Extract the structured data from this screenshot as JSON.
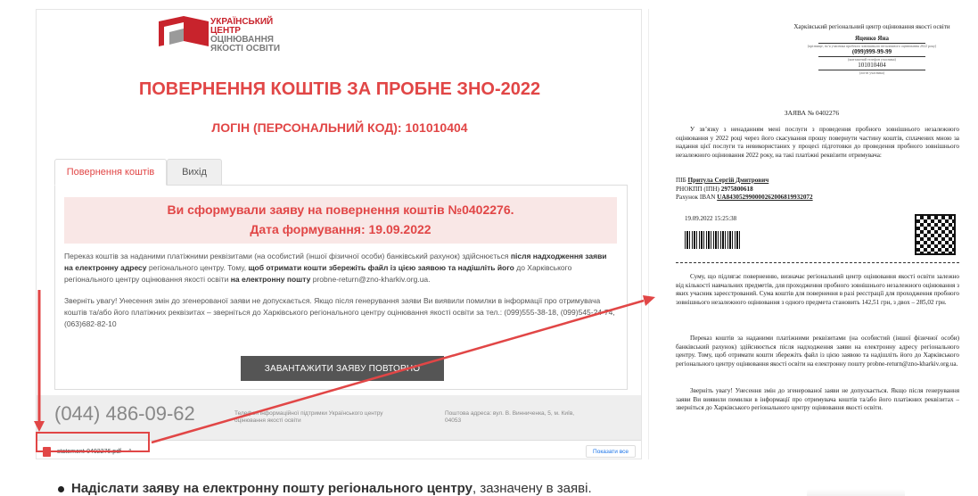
{
  "site": {
    "logo_lines": [
      "УКРАЇНСЬКИЙ",
      "ЦЕНТР",
      "ОЦІНЮВАННЯ",
      "ЯКОСТІ ОСВІТИ"
    ],
    "heading": "ПОВЕРНЕННЯ КОШТІВ ЗА ПРОБНЕ ЗНО-2022",
    "login": "ЛОГІН (ПЕРСОНАЛЬНИЙ КОД): 101010404",
    "tabs": [
      {
        "label": "Повернення коштів"
      },
      {
        "label": "Вихід"
      }
    ],
    "success_line1": "Ви сформували заяву на повернення коштів №0402276.",
    "success_line2": "Дата формування: 19.09.2022",
    "para1_a": "Переказ коштів за наданими платіжними реквізитами (на особистий (іншої фізичної особи) банківський рахунок) здійснюється ",
    "para1_b": "після надходження заяви на електронну адресу",
    "para1_c": " регіонального центру. Тому, ",
    "para1_d": "щоб отримати кошти збережіть файл із цією заявою та надішліть його",
    "para1_e": " до Харківського регіонального центру оцінювання якості освіти ",
    "para1_f": "на електронну пошту",
    "para1_g": " probne-return@zno-kharkiv.org.ua.",
    "para2": "Зверніть увагу! Унесення змін до згенерованої заяви не допускається. Якщо після генерування заяви Ви виявили помилки в інформації про отримувача коштів та/або його платіжних реквізитах – зверніться до Харківського регіонального центру оцінювання якості освіти за тел.: (099)555-38-18, (099)545-24-74, (063)682-82-10",
    "download_button": "ЗАВАНТАЖИТИ ЗАЯВУ ПОВТОРНО",
    "phone": "(044) 486-09-62",
    "support": "Телефон інформаційної підтримки Українського центру оцінювання якості освіти",
    "postal": "Поштова адреса: вул. В. Винниченка, 5, м. Київ, 04053"
  },
  "download_bar": {
    "file_name": "statement-0402276.pdf",
    "chevron": "^",
    "show_all": "Показати все"
  },
  "document": {
    "center": "Харківський регіональний центр оцінювання якості освіти",
    "name": "Яценко Яна",
    "name_hint": "(прізвище, ім’я учасника пробного зовнішнього незалежного оцінювання 2022 року)",
    "phone": "(099)999-99-99",
    "phone_hint": "(контактний телефон учасника)",
    "code": "101010404",
    "code_hint": "(логін учасника)",
    "title": "ЗАЯВА № 0402276",
    "p1": "У зв’язку з ненаданням мені послуги з проведення пробного зовнішнього незалежного оцінювання у 2022 році через його скасування прошу повернути частину коштів, сплачених мною за надання цієї послуги та невикористаних у процесі підготовки до проведення пробного зовнішнього незалежного оцінювання 2022 року, на такі платіжні реквізити отримувача:",
    "pib_label": "ПІБ ",
    "pib": "Притула Сергій Дмитрович",
    "rnokpp_label": "РНОКПП (ІПН) ",
    "rnokpp": "2975800618",
    "iban_label": "Рахунок IBAN ",
    "iban": "UA843052990000262006819932072",
    "datetime": "19.09.2022 15:25:38",
    "p2": "Суму, що підлягає поверненню, визначає регіональний центр оцінювання якості освіти залежно від кількості навчальних предметів, для проходження пробного зовнішнього незалежного оцінювання з яких учасник зареєстрований. Сума коштів для повернення в разі реєстрації для проходження пробного зовнішнього незалежного оцінювання з одного предмета становить 142,51 грн, з двох – 285,02 грн.",
    "p3": "Переказ коштів за наданими платіжними реквізитами (на особистий (іншої фізичної особи) банківський рахунок) здійснюється після надходження заяви на електронну адресу регіонального центру. Тому, щоб отримати кошти збережіть файл із цією заявою та надішліть його до Харківського регіонального центру оцінювання якості освіти на електронну пошту probne-return@zno-kharkiv.org.ua.",
    "p4": "Зверніть увагу! Унесення змін до згенерованої заяви не допускається. Якщо після генерування заяви Ви виявили помилки в інформації про отримувача коштів та/або його платіжних реквізитах – зверніться до Харківського регіонального центру оцінювання якості освіти."
  },
  "bullet": {
    "bold": "Надіслати заяву на електронну пошту регіонального центру",
    "rest": ", зазначену в заяві."
  },
  "colors": {
    "accent": "#e14646",
    "button": "#555555"
  }
}
